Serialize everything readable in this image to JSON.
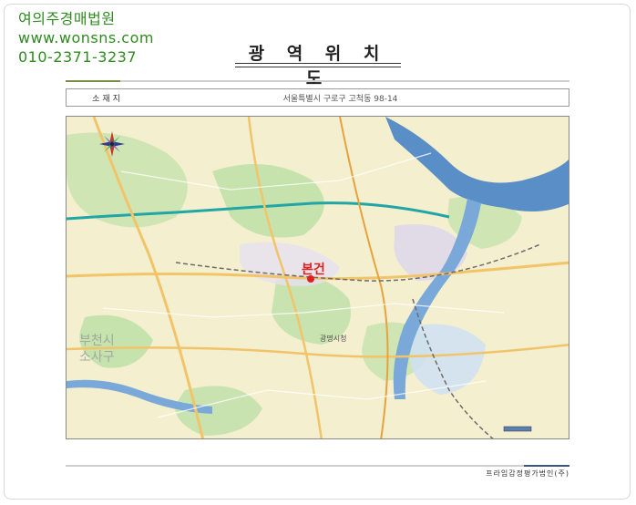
{
  "watermark": {
    "company": "여의주경매법원",
    "website": "www.wonsns.com",
    "phone": "010-2371-3237"
  },
  "document": {
    "title": "광 역 위 치 도",
    "address_label": "소재지",
    "address_value": "서울특별시 구로구 고척동 98-14",
    "footer": "프라임감정평가법인(주)"
  },
  "map": {
    "subject_label": "본건",
    "labels": {
      "bucheon": "부천시",
      "sosa": "소사구",
      "gwangmyeong": "광명시청"
    },
    "colors": {
      "land": "#f4efcf",
      "river": "#5a8ec6",
      "green": "#bfe0a8",
      "road": "#f2c46a",
      "marker": "#e02020"
    }
  }
}
